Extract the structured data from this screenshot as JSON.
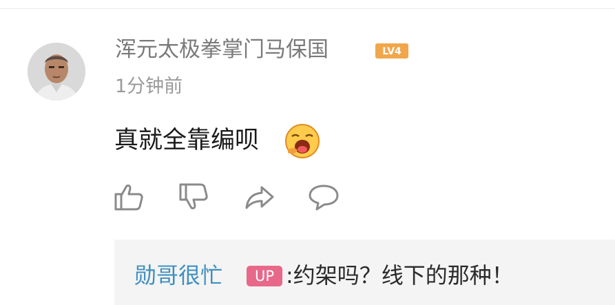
{
  "comment": {
    "username": "浑元太极拳掌门马保国",
    "level": "LV4",
    "time": "1分钟前",
    "text": "真就全靠编呗"
  },
  "icons": {
    "avatar": "user-avatar",
    "emoji": "tired-yawn-emoji",
    "like": "thumbs-up-icon",
    "dislike": "thumbs-down-icon",
    "share": "share-arrow-icon",
    "reply": "speech-bubble-icon"
  },
  "reply": {
    "author": "勋哥很忙",
    "badge": "UP",
    "text": ":约架吗？线下的那种！"
  },
  "colors": {
    "level_badge": "#f2a64a",
    "reply_author": "#3f8fc0",
    "up_badge": "#e8688a",
    "reply_bg": "#f4f4f4"
  }
}
